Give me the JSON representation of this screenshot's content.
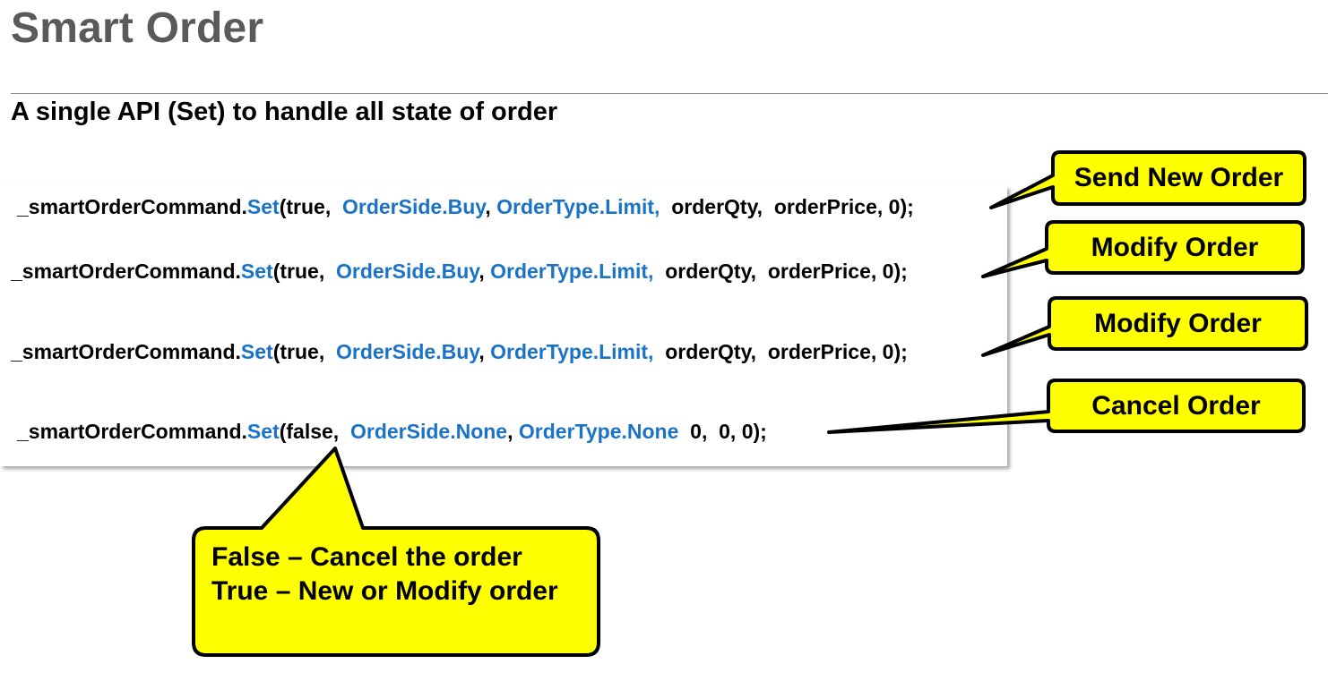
{
  "page": {
    "title": "Smart Order",
    "subtitle": "A single API (Set) to handle all state of order"
  },
  "code_lines": [
    {
      "prefix": "_smartOrderCommand.",
      "method": "Set",
      "arg1": "(true,  ",
      "side": "OrderSide.Buy",
      "sep": ", ",
      "type": "OrderType.Limit,",
      "rest": "  orderQty,  orderPrice, 0);"
    },
    {
      "prefix": "_smartOrderCommand.",
      "method": "Set",
      "arg1": "(true,  ",
      "side": "OrderSide.Buy",
      "sep": ", ",
      "type": "OrderType.Limit,",
      "rest": "  orderQty,  orderPrice, 0);"
    },
    {
      "prefix": "_smartOrderCommand.",
      "method": "Set",
      "arg1": "(true,  ",
      "side": "OrderSide.Buy",
      "sep": ", ",
      "type": "OrderType.Limit,",
      "rest": "  orderQty,  orderPrice, 0);"
    },
    {
      "prefix": "_smartOrderCommand.",
      "method": "Set",
      "arg1": "(false,  ",
      "side": "OrderSide.None",
      "sep": ", ",
      "type": "OrderType.None",
      "rest": "  0,  0, 0);"
    }
  ],
  "callouts": {
    "send_new": "Send New Order",
    "modify_1": "Modify Order",
    "modify_2": "Modify Order",
    "cancel": "Cancel Order"
  },
  "note": {
    "line1": "False – Cancel the order",
    "line2": "True – New or Modify order"
  },
  "colors": {
    "callout_fill": "#ffff00",
    "callout_border": "#000000",
    "code_keyword": "#1a73c6",
    "title_text": "#5a5a5a"
  }
}
